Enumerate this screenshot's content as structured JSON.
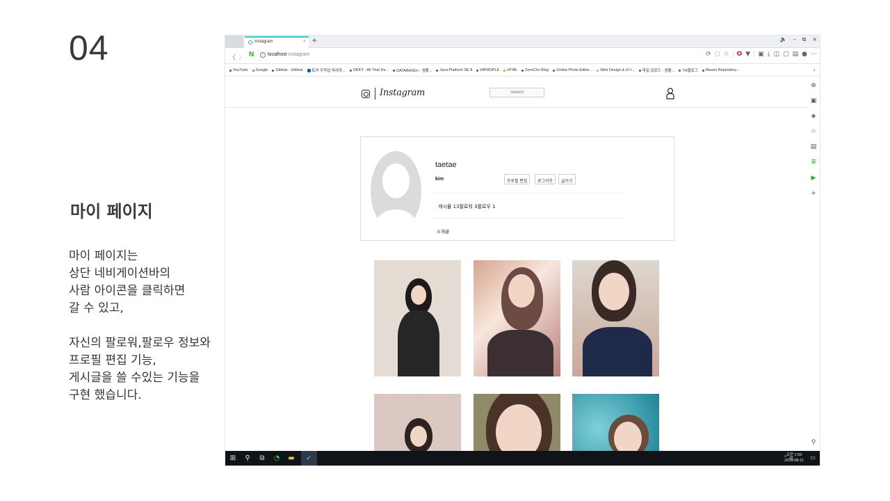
{
  "slide": {
    "number": "04",
    "title": "마이 페이지",
    "description_lines": [
      "마이 페이지는",
      "상단 네비게이션바의",
      "사람 아이콘을 클릭하면",
      "갈 수 있고,",
      "",
      "자신의 팔로워,팔로우 정보와",
      "프로필 편집 기능,",
      "게시글을 쓸 수있는 기능을",
      "구현 했습니다."
    ]
  },
  "browser": {
    "tab_title": "instagram",
    "tab_close": "×",
    "new_tab": "+",
    "window_controls": [
      "🔈",
      "–",
      "⧉",
      "×"
    ],
    "back": "〈",
    "forward": "〉",
    "naver": "N",
    "url_host": "localhost",
    "url_path": "instagram",
    "bookmarks": [
      "YouTube",
      "Google",
      "GitHub · GitHub",
      "토커 우작업 따라하...",
      "OKKY - All That De...",
      "DATABASEn - 생활...",
      "Java Platform SE 8",
      "HIPHOPLE",
      "HTML",
      "ZeroCho Blog",
      "Online Photo Editor...",
      "Web Design & UI I...",
      "파일 업로드 - 생활...",
      "TH블로그",
      "Maven Repository..."
    ],
    "bookmark_more": "›"
  },
  "instagram": {
    "wordmark": "Instagram",
    "search_placeholder": "Search",
    "profile": {
      "username": "taetae",
      "name": "kim",
      "buttons": [
        "프로필 편집",
        "로그아웃",
        "글쓰기"
      ],
      "stats": "게시물 13팔로워 3팔로우 1",
      "intro": "소개글"
    }
  },
  "taskbar": {
    "clock_line1": "오전 1:59",
    "clock_line2": "2019-08-11",
    "tray": "^ ◎"
  },
  "colors": {
    "accent": "#22cccc",
    "naver_green": "#19b219",
    "taskbar": "#101418"
  }
}
